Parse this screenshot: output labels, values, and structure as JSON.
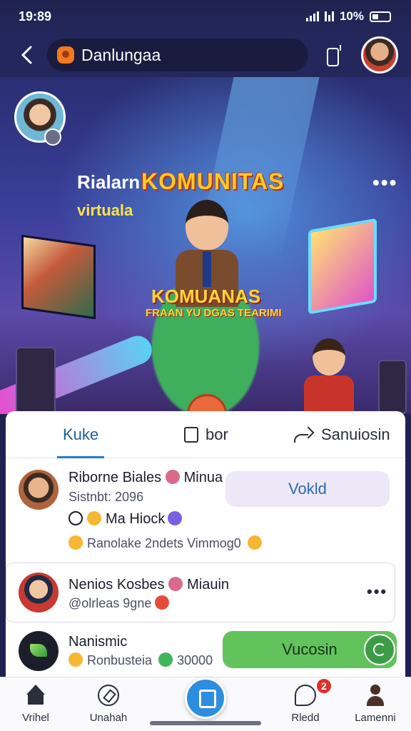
{
  "status_bar": {
    "time": "19:89",
    "battery": "10%"
  },
  "top_nav": {
    "title": "Danlungaa"
  },
  "hero": {
    "title_prefix": "Rialarn",
    "title_highlight": "KOMUNITAS",
    "subtitle": "virtuala",
    "logo_line1": "KOMUANAS",
    "logo_line2": "FRAAN YU DGAS TEARIMI",
    "more": "•••",
    "carousel_total": 3,
    "carousel_active": 3
  },
  "tabs": [
    {
      "label": "Kuke",
      "active": true
    },
    {
      "label": "bor",
      "active": false
    },
    {
      "label": "Sanuiosin",
      "active": false
    }
  ],
  "feed": [
    {
      "title": "Riborne Biales",
      "title_suffix": "Minua",
      "meta": "Sistnbt: 2096",
      "line3": "Ma",
      "line3_suffix": "Hiock",
      "line4": "Ranolake 2ndets Vimmog0",
      "action": "Vokld"
    },
    {
      "title": "Nenios Kosbes",
      "title_suffix": "Miauin",
      "meta": "@olrleas 9gne",
      "more": "•••"
    },
    {
      "title": "Nanismic",
      "meta": "Ronbusteia",
      "meta_suffix": "30000",
      "action": "Vucosin"
    }
  ],
  "bottom_nav": [
    {
      "label": "Vrihel"
    },
    {
      "label": "Unahah"
    },
    {
      "label": ""
    },
    {
      "label": "Rledd",
      "badge": "2"
    },
    {
      "label": "Lamenni"
    }
  ],
  "colors": {
    "accent": "#2a7bc2",
    "green_button": "#62c35c",
    "lavender_button": "#ece8f7",
    "badge": "#e0302a",
    "header_bg": "#24275c"
  }
}
